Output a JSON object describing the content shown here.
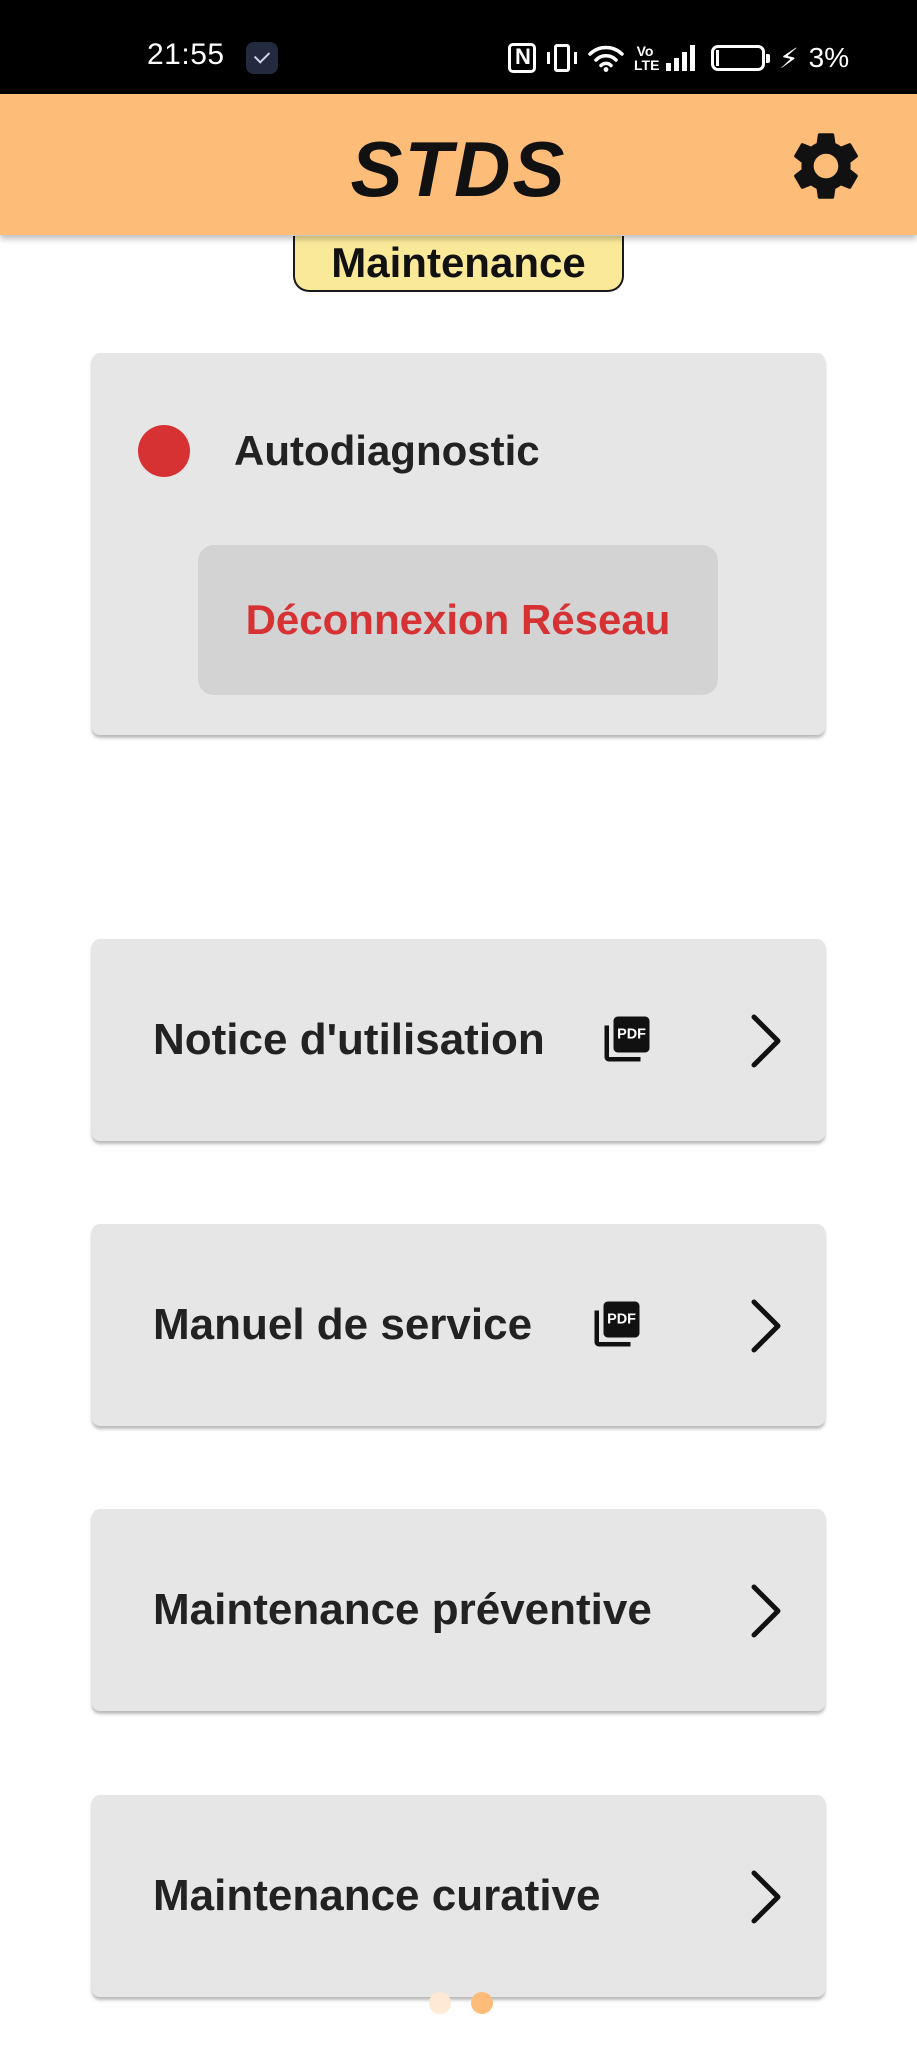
{
  "status_bar": {
    "time": "21:55",
    "network_label": "Vo\nLTE",
    "battery_percent": "3%",
    "battery_level": 0.03,
    "charging": true
  },
  "app_bar": {
    "title": "STDS",
    "settings_icon": "gear-icon",
    "color": "#fdbd79"
  },
  "section_tab": {
    "label": "Maintenance",
    "color": "#fbe99a"
  },
  "autodiagnostic": {
    "label": "Autodiagnostic",
    "indicator_color": "#d63234",
    "status": "Déconnexion Réseau",
    "status_color": "#d63234"
  },
  "menu": {
    "items": [
      {
        "label": "Notice d'utilisation",
        "icon": "pdf-icon",
        "chevron": "chevron-right-icon"
      },
      {
        "label": "Manuel de service",
        "icon": "pdf-icon",
        "chevron": "chevron-right-icon"
      },
      {
        "label": "Maintenance préventive",
        "chevron": "chevron-right-icon"
      },
      {
        "label": "Maintenance curative",
        "chevron": "chevron-right-icon"
      }
    ]
  },
  "pager": {
    "pages": 2,
    "active_index": 1,
    "active_color": "#fdbd79",
    "inactive_color": "#fde9d4"
  }
}
